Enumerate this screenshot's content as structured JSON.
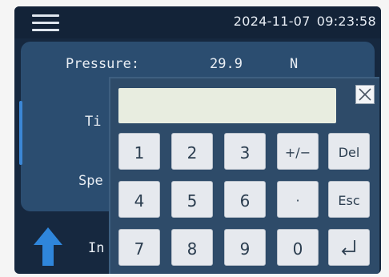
{
  "topbar": {
    "date": "2024-11-07",
    "time": "09:23:58"
  },
  "fields": {
    "pressure_label": "Pressure:",
    "pressure_value": "29.9",
    "pressure_unit": "N",
    "time_label": "Ti",
    "speed_label": "Spe",
    "interval_label": "In"
  },
  "keypad": {
    "display_value": "",
    "keys": {
      "k1": "1",
      "k2": "2",
      "k3": "3",
      "plusminus": "+/−",
      "del": "Del",
      "k4": "4",
      "k5": "5",
      "k6": "6",
      "dot": "·",
      "esc": "Esc",
      "k7": "7",
      "k8": "8",
      "k9": "9",
      "k0": "0"
    }
  },
  "colors": {
    "screen_bg": "#16283f",
    "panel_bg": "#2b4d70",
    "keypad_bg": "#2e4b69",
    "key_bg": "#e6e9ee",
    "accent_blue": "#3b87d6"
  }
}
